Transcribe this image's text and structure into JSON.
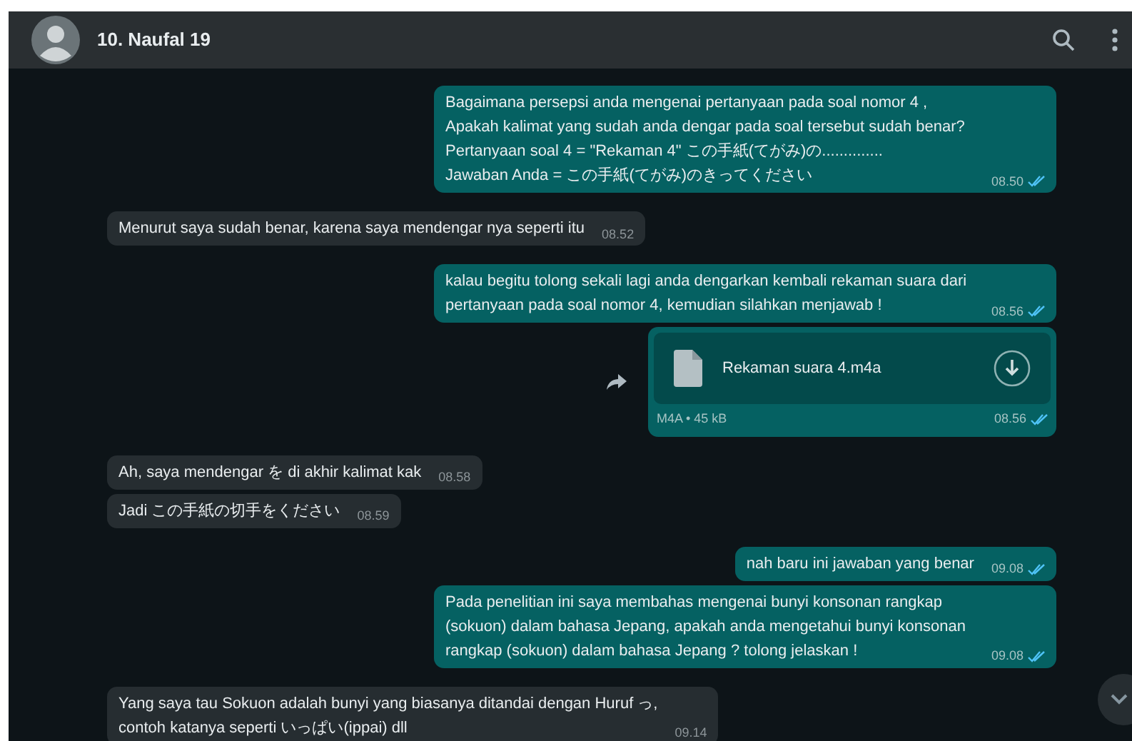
{
  "header": {
    "contact_name": "10. Naufal 19"
  },
  "messages": [
    {
      "kind": "text",
      "outgoing": true,
      "text": "Bagaimana persepsi anda mengenai pertanyaan pada soal nomor 4 , Apakah kalimat yang sudah anda dengar pada soal tersebut sudah benar?\nPertanyaan soal 4 = \"Rekaman 4\"  この手紙(てがみ)の..............\nJawaban Anda = この手紙(てがみ)のきってください",
      "time": "08.50",
      "read": true
    },
    {
      "kind": "text",
      "outgoing": false,
      "text": "Menurut saya sudah benar, karena saya mendengar nya seperti itu",
      "time": "08.52"
    },
    {
      "kind": "text",
      "outgoing": true,
      "text": "kalau begitu tolong sekali lagi anda dengarkan kembali rekaman suara dari pertanyaan pada soal nomor 4, kemudian silahkan menjawab !",
      "time": "08.56",
      "read": true
    },
    {
      "kind": "file",
      "outgoing": true,
      "file_name": "Rekaman suara 4.m4a",
      "file_info": "M4A • 45 kB",
      "time": "08.56",
      "read": true
    },
    {
      "kind": "text",
      "outgoing": false,
      "text": "Ah, saya mendengar を di akhir kalimat kak",
      "time": "08.58"
    },
    {
      "kind": "text",
      "outgoing": false,
      "text": "Jadi この手紙の切手をください",
      "time": "08.59"
    },
    {
      "kind": "text",
      "outgoing": true,
      "text": "nah baru ini jawaban yang benar",
      "time": "09.08",
      "read": true
    },
    {
      "kind": "text",
      "outgoing": true,
      "text": "Pada penelitian ini saya membahas mengenai bunyi konsonan rangkap (sokuon) dalam bahasa Jepang, apakah anda mengetahui bunyi konsonan rangkap (sokuon) dalam bahasa Jepang ? tolong jelaskan !",
      "time": "09.08",
      "read": true
    },
    {
      "kind": "text",
      "outgoing": false,
      "text": "Yang saya tau Sokuon adalah bunyi yang biasanya ditandai dengan Huruf っ,\ncontoh katanya seperti いっぱい(ippai) dll",
      "time": "09.14"
    }
  ]
}
